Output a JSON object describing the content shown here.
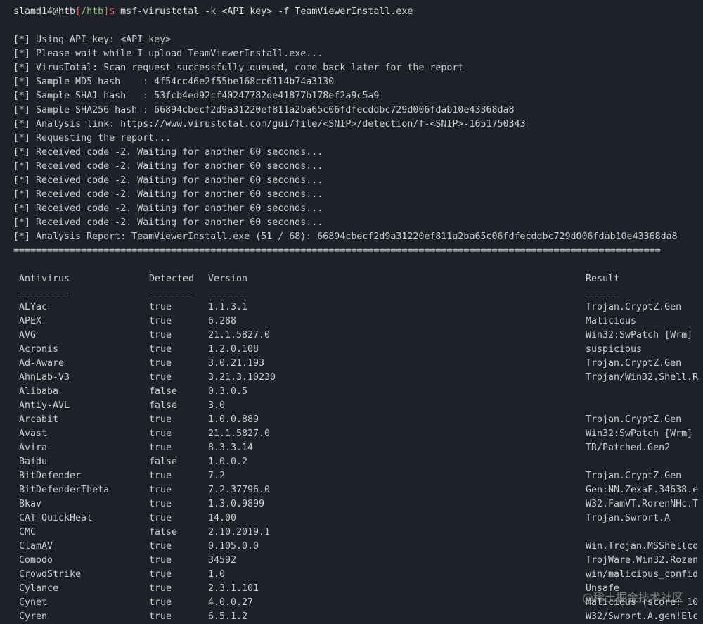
{
  "prompt": {
    "user": "slamd14@htb",
    "lb": "[",
    "path": "/htb",
    "rb": "]",
    "dollar": "$",
    "command": " msf-virustotal -k <API key> -f TeamViewerInstall.exe"
  },
  "output_lines": [
    "[*] Using API key: <API key>",
    "[*] Please wait while I upload TeamViewerInstall.exe...",
    "[*] VirusTotal: Scan request successfully queued, come back later for the report",
    "[*] Sample MD5 hash    : 4f54cc46e2f55be168cc6114b74a3130",
    "[*] Sample SHA1 hash   : 53fcb4ed92cf40247782de41877b178ef2a9c5a9",
    "[*] Sample SHA256 hash : 66894cbecf2d9a31220ef811a2ba65c06fdfecddbc729d006fdab10e43368da8",
    "[*] Analysis link: https://www.virustotal.com/gui/file/<SNIP>/detection/f-<SNIP>-1651750343",
    "[*] Requesting the report...",
    "[*] Received code -2. Waiting for another 60 seconds...",
    "[*] Received code -2. Waiting for another 60 seconds...",
    "[*] Received code -2. Waiting for another 60 seconds...",
    "[*] Received code -2. Waiting for another 60 seconds...",
    "[*] Received code -2. Waiting for another 60 seconds...",
    "[*] Received code -2. Waiting for another 60 seconds...",
    "[*] Analysis Report: TeamViewerInstall.exe (51 / 68): 66894cbecf2d9a31220ef811a2ba65c06fdfecddbc729d006fdab10e43368da8",
    "==================================================================================================================="
  ],
  "table": {
    "headers": [
      "Antivirus",
      "Detected",
      "Version",
      "Result"
    ],
    "underline": [
      "---------",
      "--------",
      "-------",
      "------"
    ],
    "rows": [
      [
        "ALYac",
        "true",
        "1.1.3.1",
        "Trojan.CryptZ.Gen"
      ],
      [
        "APEX",
        "true",
        "6.288",
        "Malicious"
      ],
      [
        "AVG",
        "true",
        "21.1.5827.0",
        "Win32:SwPatch [Wrm]"
      ],
      [
        "Acronis",
        "true",
        "1.2.0.108",
        "suspicious"
      ],
      [
        "Ad-Aware",
        "true",
        "3.0.21.193",
        "Trojan.CryptZ.Gen"
      ],
      [
        "AhnLab-V3",
        "true",
        "3.21.3.10230",
        "Trojan/Win32.Shell.R"
      ],
      [
        "Alibaba",
        "false",
        "0.3.0.5",
        ""
      ],
      [
        "Antiy-AVL",
        "false",
        "3.0",
        ""
      ],
      [
        "Arcabit",
        "true",
        "1.0.0.889",
        "Trojan.CryptZ.Gen"
      ],
      [
        "Avast",
        "true",
        "21.1.5827.0",
        "Win32:SwPatch [Wrm]"
      ],
      [
        "Avira",
        "true",
        "8.3.3.14",
        "TR/Patched.Gen2"
      ],
      [
        "Baidu",
        "false",
        "1.0.0.2",
        ""
      ],
      [
        "BitDefender",
        "true",
        "7.2",
        "Trojan.CryptZ.Gen"
      ],
      [
        "BitDefenderTheta",
        "true",
        "7.2.37796.0",
        "Gen:NN.ZexaF.34638.e"
      ],
      [
        "Bkav",
        "true",
        "1.3.0.9899",
        "W32.FamVT.RorenNHc.T"
      ],
      [
        "CAT-QuickHeal",
        "true",
        "14.00",
        "Trojan.Swrort.A"
      ],
      [
        "CMC",
        "false",
        "2.10.2019.1",
        ""
      ],
      [
        "ClamAV",
        "true",
        "0.105.0.0",
        "Win.Trojan.MSShellco"
      ],
      [
        "Comodo",
        "true",
        "34592",
        "TrojWare.Win32.Rozen"
      ],
      [
        "CrowdStrike",
        "true",
        "1.0",
        "win/malicious_confid"
      ],
      [
        "Cylance",
        "true",
        "2.3.1.101",
        "Unsafe"
      ],
      [
        "Cynet",
        "true",
        "4.0.0.27",
        "Malicious (score: 10"
      ],
      [
        "Cyren",
        "true",
        "6.5.1.2",
        "W32/Swrort.A.gen!Elc"
      ]
    ]
  },
  "watermark": "@稀土掘金技术社区"
}
